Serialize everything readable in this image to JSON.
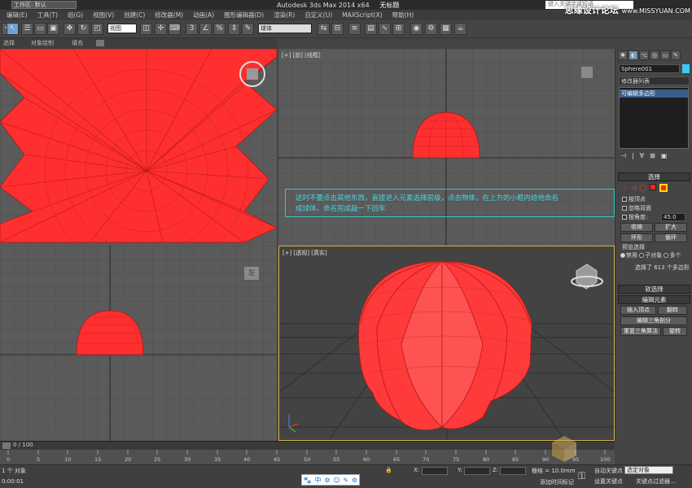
{
  "window": {
    "workspace_label": "工作区: 默认",
    "app_title": "Autodesk 3ds Max  2014 x64",
    "doc_title": "无标题",
    "search_placeholder": "键入关键字或短语",
    "site_watermark": "思缘设计论坛",
    "site_url": "www.MISSYUAN.COM"
  },
  "menu": [
    "编辑(E)",
    "工具(T)",
    "组(G)",
    "视图(V)",
    "创建(C)",
    "修改器(M)",
    "动画(A)",
    "图形编辑器(D)",
    "渲染(R)",
    "自定义(U)",
    "MAXScript(X)",
    "帮助(H)"
  ],
  "toolbar": {
    "filter_dropdown": "全部",
    "coord_dropdown": "视图",
    "named_selection": "球体"
  },
  "ribbon": {
    "tab1": "选择",
    "tab2": "对象绘制",
    "tab3": "填充"
  },
  "viewports": {
    "front_label": "[+] [前] [线框]",
    "persp_label": "[+] [透视] [真实]",
    "left_viewcube": "左",
    "front_viewcube": "前"
  },
  "annotation": {
    "line1": "这时不要点击其他东西，直接进入元素选择层级，点击物体，在上方的小框内给他命名",
    "line2": "成球体，命名完成敲一下回车"
  },
  "command_panel": {
    "object_name": "Sphere001",
    "modifier_list": "修改器列表",
    "stack_item": "可编辑多边形",
    "selection_title": "选择",
    "by_vertex": "按顶点",
    "ignore_backface": "忽略背面",
    "by_angle": "按角度:",
    "angle_value": "45.0",
    "shrink": "收缩",
    "grow": "扩大",
    "ring": "环形",
    "loop": "循环",
    "preview_title": "预览选择",
    "disabled": "禁用",
    "subobject": "子对象",
    "multi": "多个",
    "selected_info": "选择了 613 个多边形",
    "soft_selection": "软选择",
    "edit_elements": "编辑元素",
    "insert_vertex": "插入顶点",
    "flip": "翻转",
    "edit_triangulation": "编辑三角剖分",
    "retriangulate": "重复三角算法",
    "turn": "旋转"
  },
  "timeline": {
    "slider": "0 / 100",
    "ticks": [
      "0",
      "5",
      "10",
      "15",
      "20",
      "25",
      "30",
      "35",
      "40",
      "45",
      "50",
      "55",
      "60",
      "65",
      "70",
      "75",
      "80",
      "85",
      "90",
      "95",
      "100"
    ]
  },
  "status": {
    "left_label": "1 个 对象",
    "left_bottom": "0:00:01",
    "x_label": "X:",
    "y_label": "Y:",
    "z_label": "Z:",
    "grid": "栅格 = 10.0mm",
    "auto_key": "自动关键点",
    "selected_object": "选定对象",
    "set_key": "设置关键点",
    "key_filter": "关键点过滤器...",
    "add_time_tag": "添加时间标记"
  },
  "colors": {
    "object_red": "#ff2f2f",
    "annotation_cyan": "#46d6e0",
    "active_viewport_border": "#d8b24a"
  }
}
